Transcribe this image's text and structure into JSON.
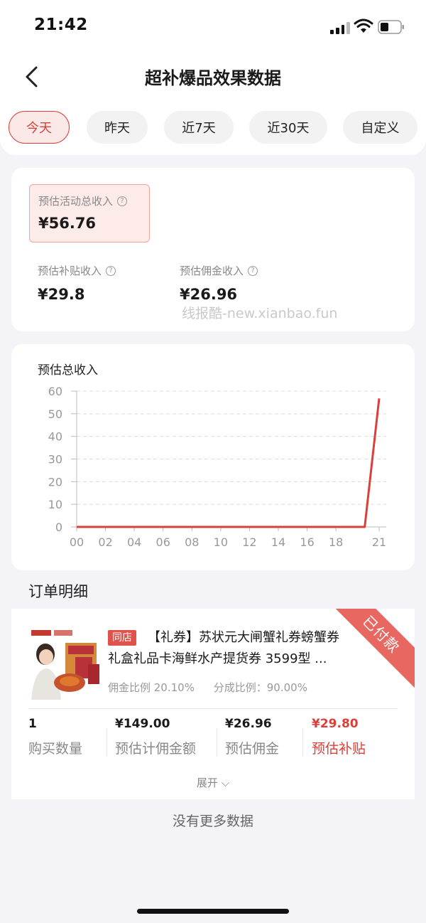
{
  "status_bar": {
    "time": "21:42"
  },
  "nav": {
    "title": "超补爆品效果数据"
  },
  "tabs": [
    {
      "label": "今天",
      "active": true
    },
    {
      "label": "昨天",
      "active": false
    },
    {
      "label": "近7天",
      "active": false
    },
    {
      "label": "近30天",
      "active": false
    },
    {
      "label": "自定义",
      "active": false
    }
  ],
  "summary": {
    "total_label": "预估活动总收入",
    "total_value": "¥56.76",
    "subsidy_label": "预估补贴收入",
    "subsidy_value": "¥29.8",
    "commission_label": "预估佣金收入",
    "commission_value": "¥26.96",
    "help_icon": "?",
    "watermark": "线报酷-new.xianbao.fun"
  },
  "chart_data": {
    "type": "line",
    "title": "预估总收入",
    "x": [
      "00",
      "02",
      "04",
      "06",
      "08",
      "10",
      "12",
      "14",
      "16",
      "18",
      "20",
      "21"
    ],
    "x_tick_labels": [
      "00",
      "02",
      "04",
      "06",
      "08",
      "10",
      "12",
      "14",
      "16",
      "18",
      "21"
    ],
    "series": [
      {
        "values": [
          0,
          0,
          0,
          0,
          0,
          0,
          0,
          0,
          0,
          0,
          0,
          56.76
        ]
      }
    ],
    "y_ticks": [
      0,
      10,
      20,
      30,
      40,
      50,
      60
    ],
    "ylim": [
      0,
      60
    ],
    "grid": "horizontal dashed",
    "color": "#d9403a"
  },
  "orders": {
    "section_title": "订单明细",
    "item": {
      "shop_tag": "同店",
      "title_line1": "【礼券】苏状元大闸蟹礼券螃蟹券",
      "title_line2": "礼盒礼品卡海鲜水产提货券 3599型 ...",
      "commission_rate": "佣金比例 20.10%",
      "share_rate": "分成比例：90.00%",
      "status": "已付款",
      "quantity": "1",
      "quantity_label": "购买数量",
      "base_amount": "¥149.00",
      "base_amount_label": "预估计佣金额",
      "commission": "¥26.96",
      "commission_label": "预估佣金",
      "subsidy": "¥29.80",
      "subsidy_label": "预估补贴",
      "expand_label": "展开 ⌵"
    }
  },
  "footer": {
    "no_more": "没有更多数据"
  },
  "colors": {
    "accent": "#d9403a",
    "background": "#f4f3f7"
  }
}
